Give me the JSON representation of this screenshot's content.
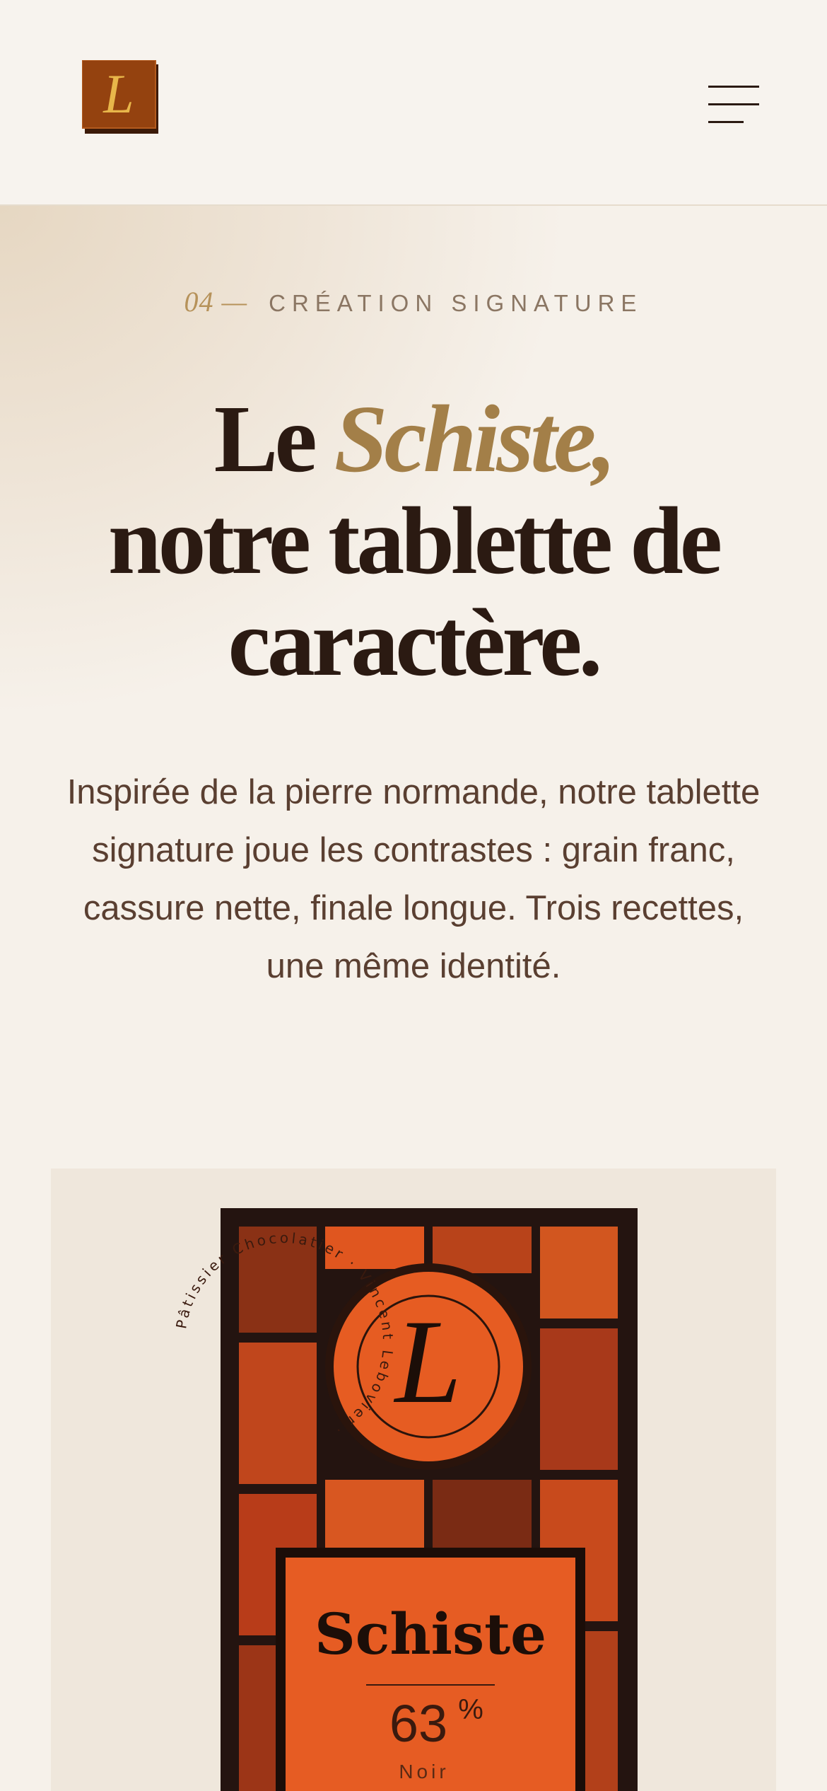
{
  "header": {
    "logo_letter": "L",
    "menu_icon": "hamburger-menu-icon"
  },
  "hero": {
    "eyebrow_number": "04 —",
    "eyebrow_label": "CRÉATION SIGNATURE",
    "title_line1_plain": "Le ",
    "title_line1_accent": "Schiste,",
    "title_line2": "notre tablette de",
    "title_line3": "caractère.",
    "lead": "Inspirée de la pierre normande, notre tablette signature joue les contrastes : grain franc, cassure nette, finale longue. Trois recettes, une même identité."
  },
  "product": {
    "seal_letter": "L",
    "seal_text": "Pâtissier Chocolatier · Vincent Lebovier ·",
    "name": "Schiste",
    "percentage": "63",
    "percent_sign": "%",
    "variant": "Noir"
  },
  "colors": {
    "accent_gold": "#a37f48",
    "text_dark": "#2b1a12",
    "orange": "#e35a23",
    "logo_brown": "#8e3f10"
  }
}
